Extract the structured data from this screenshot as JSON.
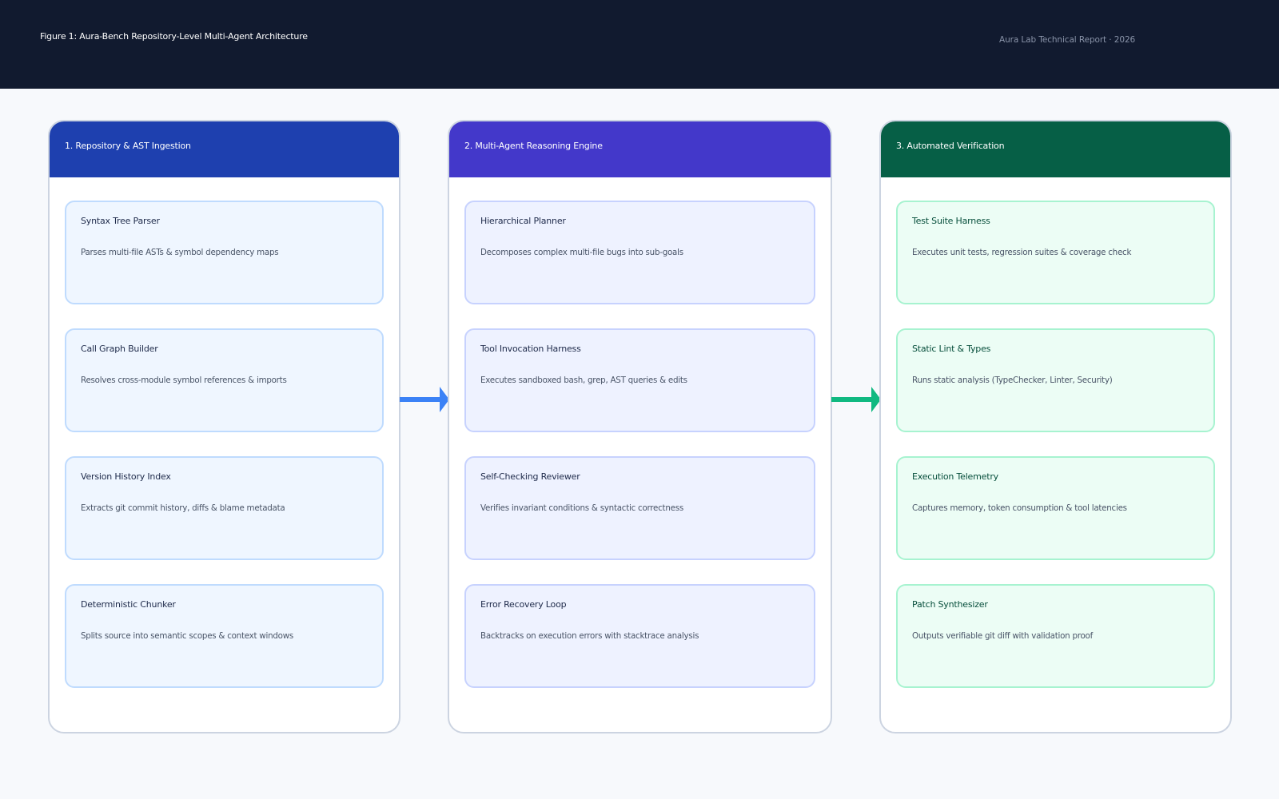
{
  "header": {
    "figure_title": "Figure 1: Aura-Bench Repository-Level Multi-Agent Architecture",
    "report_label": "Aura Lab Technical Report · 2026"
  },
  "colors": {
    "header_bg": "#111a2f",
    "ingestion_accent": "#1e40af",
    "reasoning_accent": "#4338ca",
    "verification_accent": "#065f46",
    "arrow_blue": "#3b82f6",
    "arrow_green": "#10b981"
  },
  "columns": [
    {
      "title": "1. Repository & AST Ingestion",
      "cards": [
        {
          "title": "Syntax Tree Parser",
          "desc": "Parses multi-file ASTs & symbol dependency maps"
        },
        {
          "title": "Call Graph Builder",
          "desc": "Resolves cross-module symbol references & imports"
        },
        {
          "title": "Version History Index",
          "desc": "Extracts git commit history, diffs & blame metadata"
        },
        {
          "title": "Deterministic Chunker",
          "desc": "Splits source into semantic scopes & context windows"
        }
      ]
    },
    {
      "title": "2. Multi-Agent Reasoning Engine",
      "cards": [
        {
          "title": "Hierarchical Planner",
          "desc": "Decomposes complex multi-file bugs into sub-goals"
        },
        {
          "title": "Tool Invocation Harness",
          "desc": "Executes sandboxed bash, grep, AST queries & edits"
        },
        {
          "title": "Self-Checking Reviewer",
          "desc": "Verifies invariant conditions & syntactic correctness"
        },
        {
          "title": "Error Recovery Loop",
          "desc": "Backtracks on execution errors with stacktrace analysis"
        }
      ]
    },
    {
      "title": "3. Automated Verification",
      "cards": [
        {
          "title": "Test Suite Harness",
          "desc": "Executes unit tests, regression suites & coverage check"
        },
        {
          "title": "Static Lint & Types",
          "desc": "Runs static analysis (TypeChecker, Linter, Security)"
        },
        {
          "title": "Execution Telemetry",
          "desc": "Captures memory, token consumption & tool latencies"
        },
        {
          "title": "Patch Synthesizer",
          "desc": "Outputs verifiable git diff with validation proof"
        }
      ]
    }
  ]
}
